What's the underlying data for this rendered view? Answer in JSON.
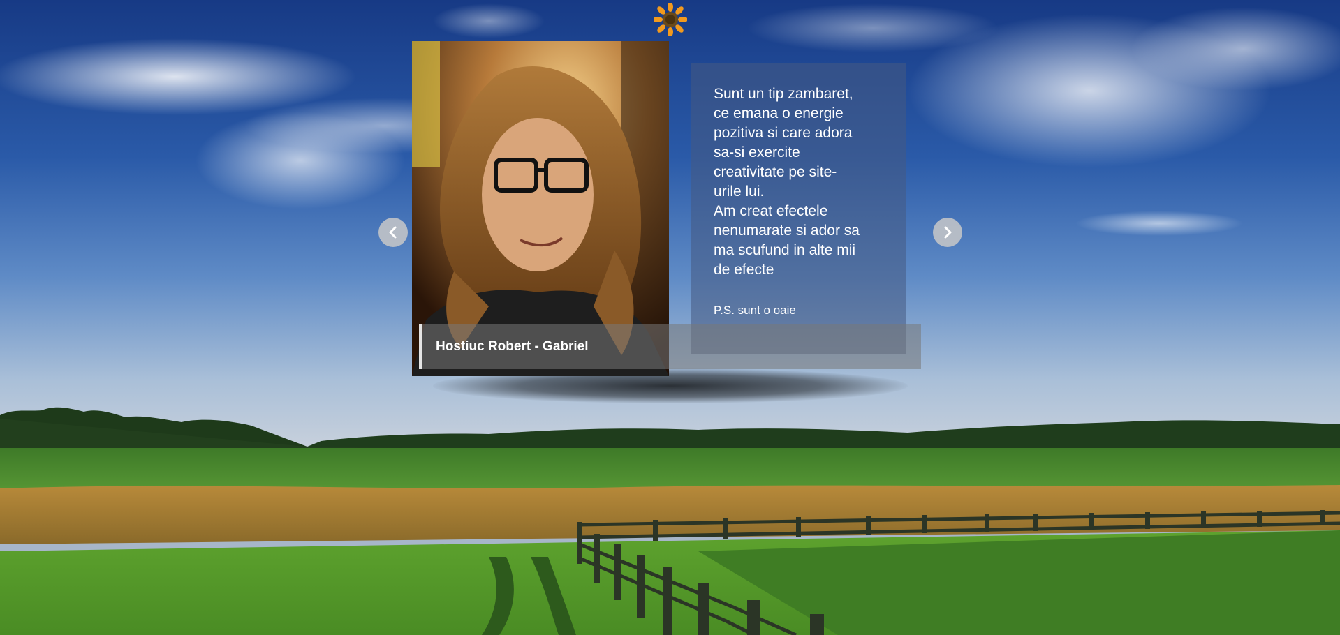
{
  "profile": {
    "name": "Hostiuc Robert - Gabriel",
    "bio": "Sunt un tip zambaret,\nce emana o energie\npozitiva si care adora\nsa-si exercite\ncreativitate pe site-\nurile lui.\nAm creat efectele\nnenumarate si ador sa\nma scufund in alte mii\nde efecte",
    "ps": "P.S. sunt o oaie"
  },
  "icons": {
    "logo": "sunflower-icon",
    "prev": "chevron-left-icon",
    "next": "chevron-right-icon"
  },
  "colors": {
    "sky_top": "#1a3e86",
    "field_green": "#4f8f2a",
    "panel_bg": "#46598266",
    "arrow_bg": "#c8c8c8"
  }
}
